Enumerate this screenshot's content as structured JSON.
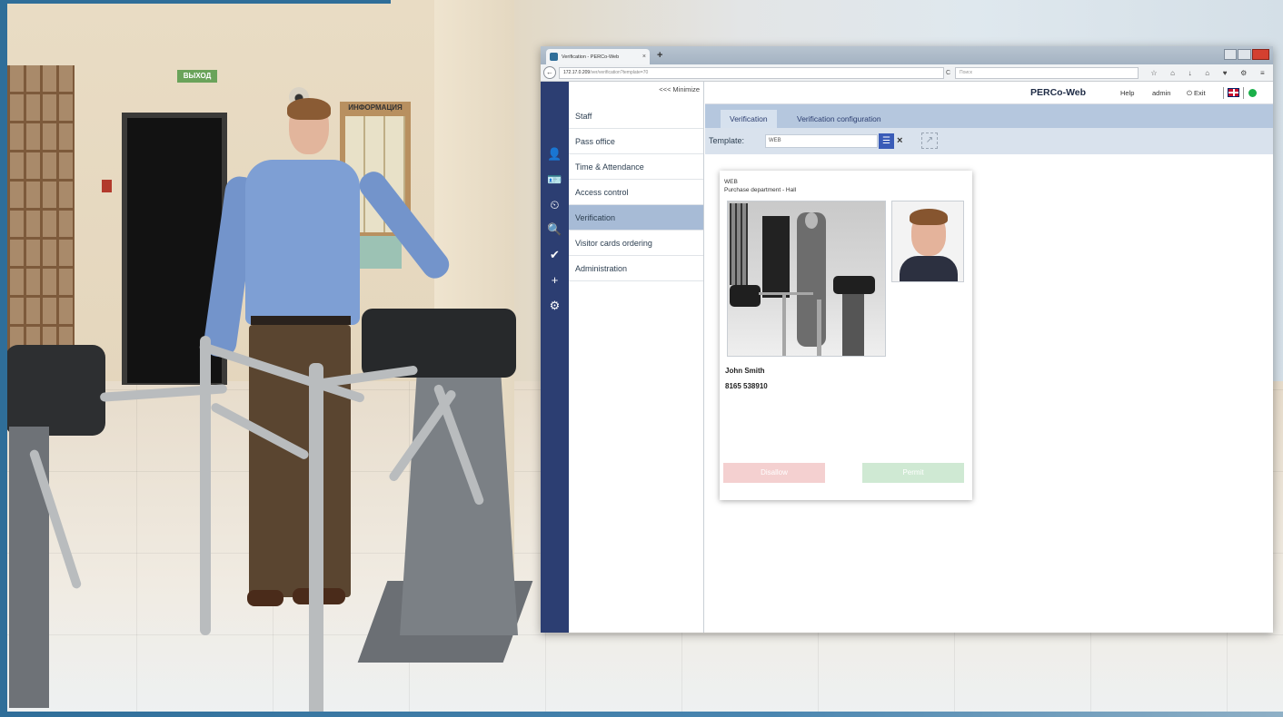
{
  "browser": {
    "tab_title": "Verification - PERCo-Web",
    "tab_close": "×",
    "new_tab": "+",
    "back": "←",
    "url_host": "172.17.0.209",
    "url_path": "/ver/verification?template=70",
    "reload": "C",
    "search_placeholder": "Поиск",
    "toolbar_icons": [
      "☆",
      "⌂",
      "↓",
      "⌂",
      "♥",
      "⚙",
      "≡"
    ]
  },
  "photo": {
    "exit_sign": "ВЫХОД",
    "info_board_title": "ИНФОРМАЦИЯ"
  },
  "sidebar": {
    "minimize_label": "<<< Minimize",
    "rail_icons": [
      "👤",
      "🪪",
      "⏲",
      "🔍",
      "✔",
      "+",
      "⚙"
    ],
    "items": [
      {
        "label": "Staff"
      },
      {
        "label": "Pass office"
      },
      {
        "label": "Time & Attendance"
      },
      {
        "label": "Access control"
      },
      {
        "label": "Verification",
        "active": true
      },
      {
        "label": "Visitor cards ordering"
      },
      {
        "label": "Administration"
      }
    ]
  },
  "header": {
    "brand": "PERCo-Web",
    "help": "Help",
    "user": "admin",
    "exit": "Exit",
    "exit_icon": "⏻",
    "status_color": "#1bb04a"
  },
  "tabs": [
    {
      "label": "Verification",
      "active": true
    },
    {
      "label": "Verification configuration"
    }
  ],
  "template": {
    "label": "Template:",
    "value": "WEB",
    "list_icon": "☰",
    "clear_icon": "×",
    "open_icon": "↗"
  },
  "card": {
    "template_name": "WEB",
    "location": "Purchase department - Hall",
    "person_name": "John Smith",
    "card_number": "8165 538910",
    "disallow_label": "Disallow",
    "permit_label": "Permit"
  },
  "colors": {
    "rail": "#2c3e72",
    "active_menu": "#a7bbd6",
    "tabs_bar": "#b5c7de",
    "disallow": "#f4d0d0",
    "permit": "#cfe9d3"
  }
}
